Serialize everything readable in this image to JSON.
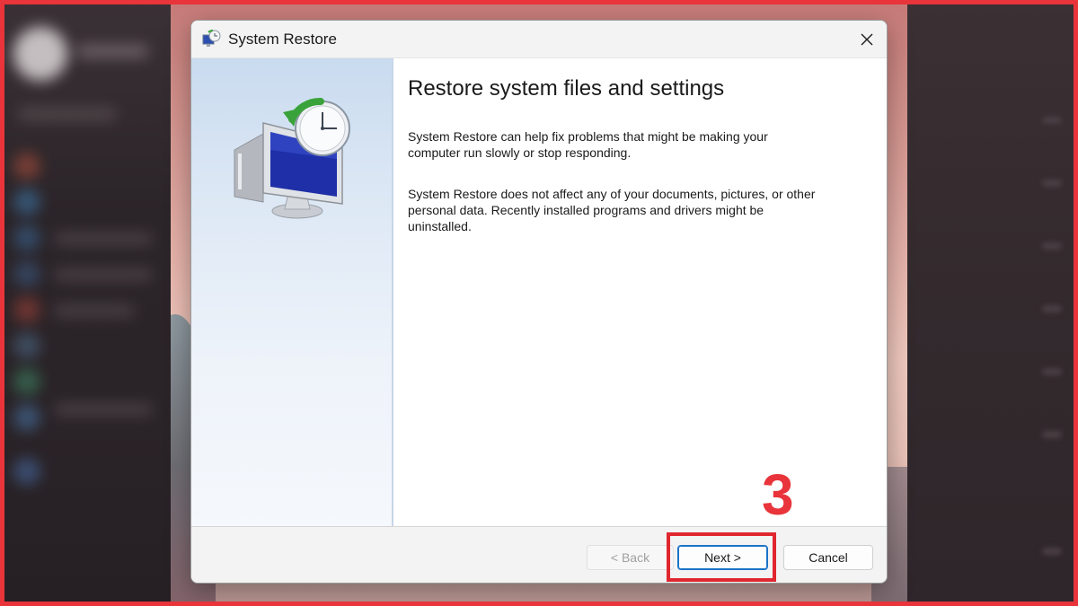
{
  "window": {
    "title": "System Restore",
    "close_icon": "close-icon",
    "app_icon": "system-restore-icon"
  },
  "content": {
    "heading": "Restore system files and settings",
    "paragraph1": "System Restore can help fix problems that might be making your computer run slowly or stop responding.",
    "paragraph2": "System Restore does not affect any of your documents, pictures, or other personal data. Recently installed programs and drivers might be uninstalled.",
    "hero_icon": "system-restore-monitor-clock-icon"
  },
  "buttons": {
    "back": "< Back",
    "next": "Next >",
    "cancel": "Cancel",
    "back_enabled": false
  },
  "annotation": {
    "step": "3",
    "color": "#e8343a"
  },
  "colors": {
    "accent": "#1a73c7",
    "annotation_red": "#e0262e",
    "side_panel": "#dde8f5"
  }
}
